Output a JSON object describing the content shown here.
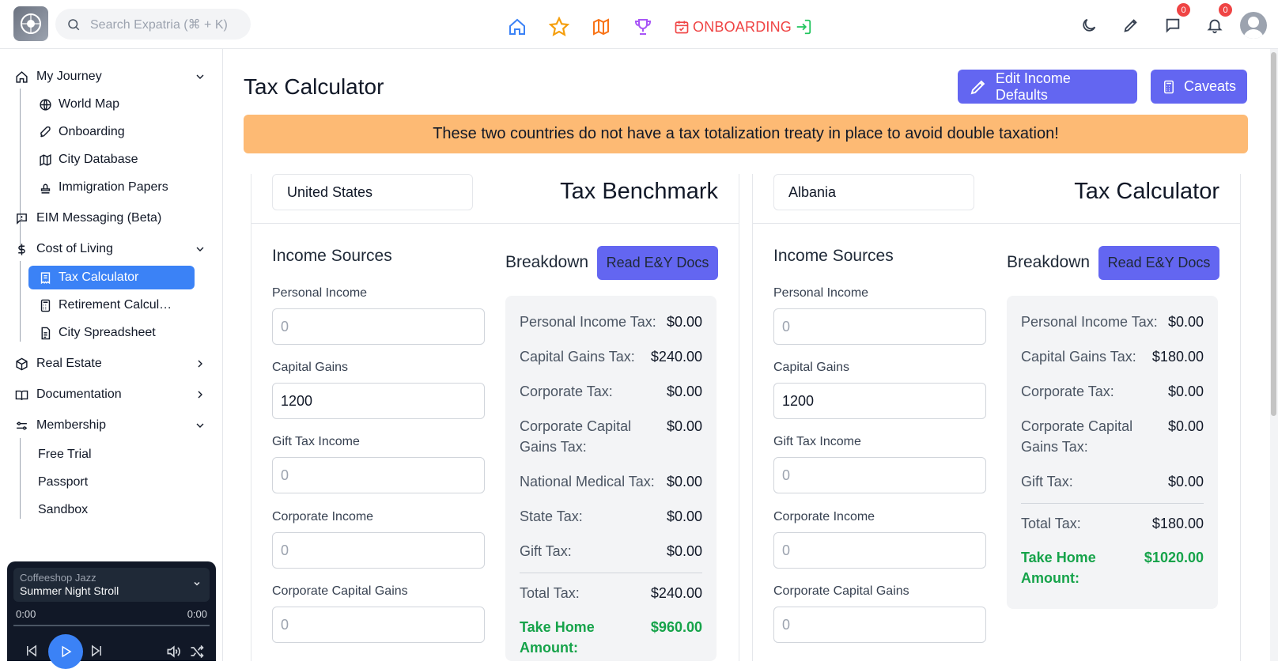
{
  "search": {
    "placeholder": "Search Expatria (⌘ + K)"
  },
  "topnav": {
    "onboarding_label": "ONBOARDING"
  },
  "notifications": {
    "messages_count": "0",
    "alerts_count": "0"
  },
  "sidebar": {
    "my_journey": "My Journey",
    "world_map": "World Map",
    "onboarding": "Onboarding",
    "city_database": "City Database",
    "immigration_papers": "Immigration Papers",
    "eim_messaging": "EIM Messaging (Beta)",
    "cost_of_living": "Cost of Living",
    "tax_calculator": "Tax Calculator",
    "retirement_calculator": "Retirement Calcul…",
    "city_spreadsheet": "City Spreadsheet",
    "real_estate": "Real Estate",
    "documentation": "Documentation",
    "membership": "Membership",
    "free_trial": "Free Trial",
    "passport": "Passport",
    "sandbox": "Sandbox"
  },
  "player": {
    "genre": "Coffeeshop Jazz",
    "track": "Summer Night Stroll",
    "elapsed": "0:00",
    "duration": "0:00"
  },
  "page": {
    "title": "Tax Calculator",
    "edit_defaults_label": "Edit Income Defaults",
    "caveats_label": "Caveats",
    "alert": "These two countries do not have a tax totalization treaty in place to avoid double taxation!"
  },
  "left": {
    "country": "United States",
    "title": "Tax Benchmark",
    "income_title": "Income Sources",
    "breakdown_title": "Breakdown",
    "docs_label": "Read E&Y Docs",
    "fields": [
      {
        "label": "Personal Income",
        "value": "0"
      },
      {
        "label": "Capital Gains",
        "value": "1200"
      },
      {
        "label": "Gift Tax Income",
        "value": "0"
      },
      {
        "label": "Corporate Income",
        "value": "0"
      },
      {
        "label": "Corporate Capital Gains",
        "value": "0"
      }
    ],
    "breakdown": [
      {
        "label": "Personal Income Tax:",
        "value": "$0.00"
      },
      {
        "label": "Capital Gains Tax:",
        "value": "$240.00"
      },
      {
        "label": "Corporate Tax:",
        "value": "$0.00"
      },
      {
        "label": "Corporate Capital Gains Tax:",
        "value": "$0.00"
      },
      {
        "label": "National Medical Tax:",
        "value": "$0.00"
      },
      {
        "label": "State Tax:",
        "value": "$0.00"
      },
      {
        "label": "Gift Tax:",
        "value": "$0.00"
      }
    ],
    "total_label": "Total Tax:",
    "total_value": "$240.00",
    "take_home_label": "Take Home Amount:",
    "take_home_value": "$960.00"
  },
  "right": {
    "country": "Albania",
    "title": "Tax Calculator",
    "income_title": "Income Sources",
    "breakdown_title": "Breakdown",
    "docs_label": "Read E&Y Docs",
    "fields": [
      {
        "label": "Personal Income",
        "value": "0"
      },
      {
        "label": "Capital Gains",
        "value": "1200"
      },
      {
        "label": "Gift Tax Income",
        "value": "0"
      },
      {
        "label": "Corporate Income",
        "value": "0"
      },
      {
        "label": "Corporate Capital Gains",
        "value": "0"
      }
    ],
    "breakdown": [
      {
        "label": "Personal Income Tax:",
        "value": "$0.00"
      },
      {
        "label": "Capital Gains Tax:",
        "value": "$180.00"
      },
      {
        "label": "Corporate Tax:",
        "value": "$0.00"
      },
      {
        "label": "Corporate Capital Gains Tax:",
        "value": "$0.00"
      },
      {
        "label": "Gift Tax:",
        "value": "$0.00"
      }
    ],
    "total_label": "Total Tax:",
    "total_value": "$180.00",
    "take_home_label": "Take Home Amount:",
    "take_home_value": "$1020.00"
  },
  "colors": {
    "accent": "#6366f1",
    "active_nav": "#3b82f6",
    "alert_bg": "#fdba74",
    "take_home": "#16a34a",
    "badge": "#ef4444"
  }
}
